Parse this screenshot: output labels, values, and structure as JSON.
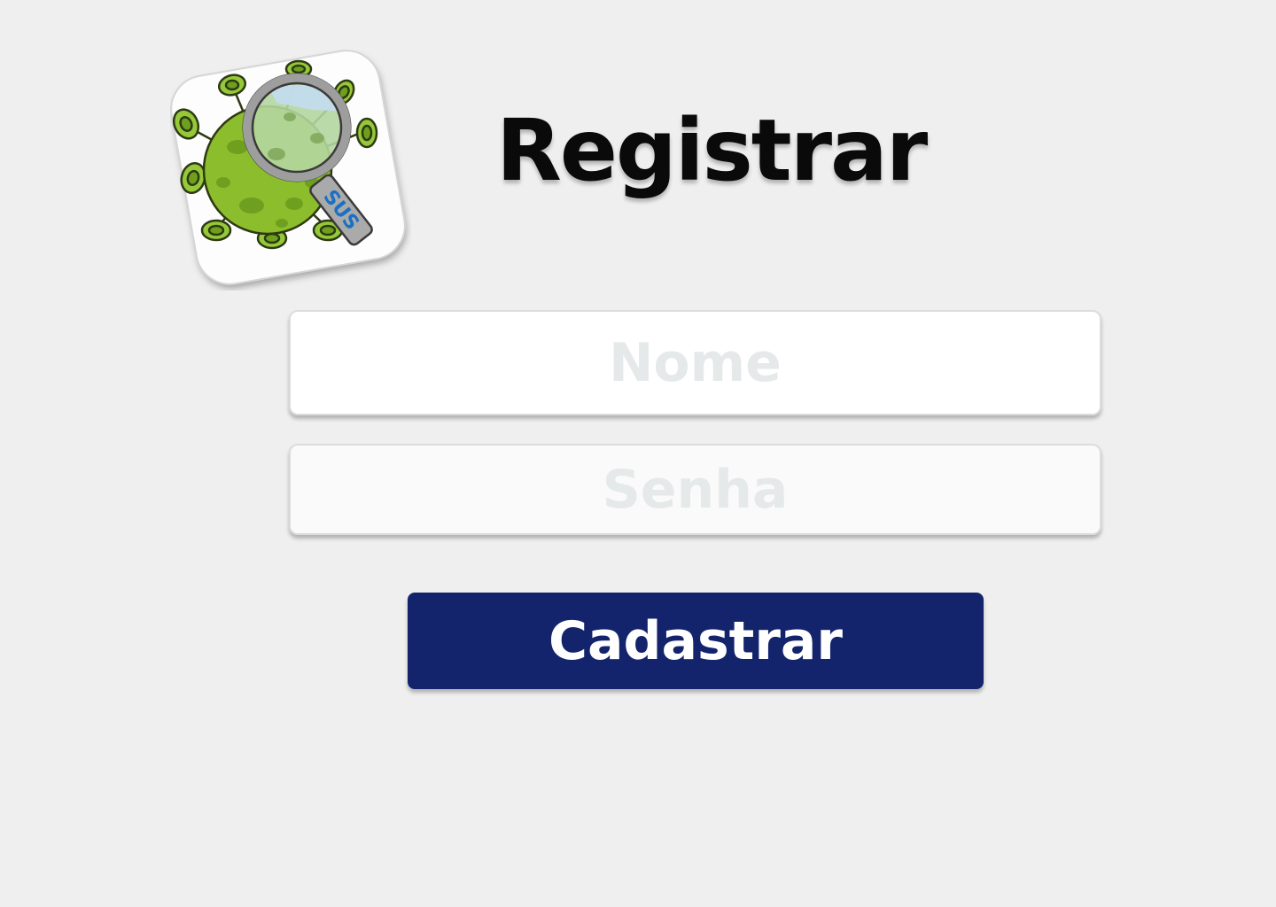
{
  "header": {
    "title": "Registrar"
  },
  "logo": {
    "icon": "virus-magnifier-icon",
    "badge_text": "SUS"
  },
  "form": {
    "name_placeholder": "Nome",
    "password_placeholder": "Senha",
    "submit_label": "Cadastrar"
  },
  "colors": {
    "background": "#efefef",
    "button": "#13246d",
    "button_text": "#ffffff",
    "virus_green": "#8cbd2c",
    "badge_blue": "#1b6fc4"
  }
}
